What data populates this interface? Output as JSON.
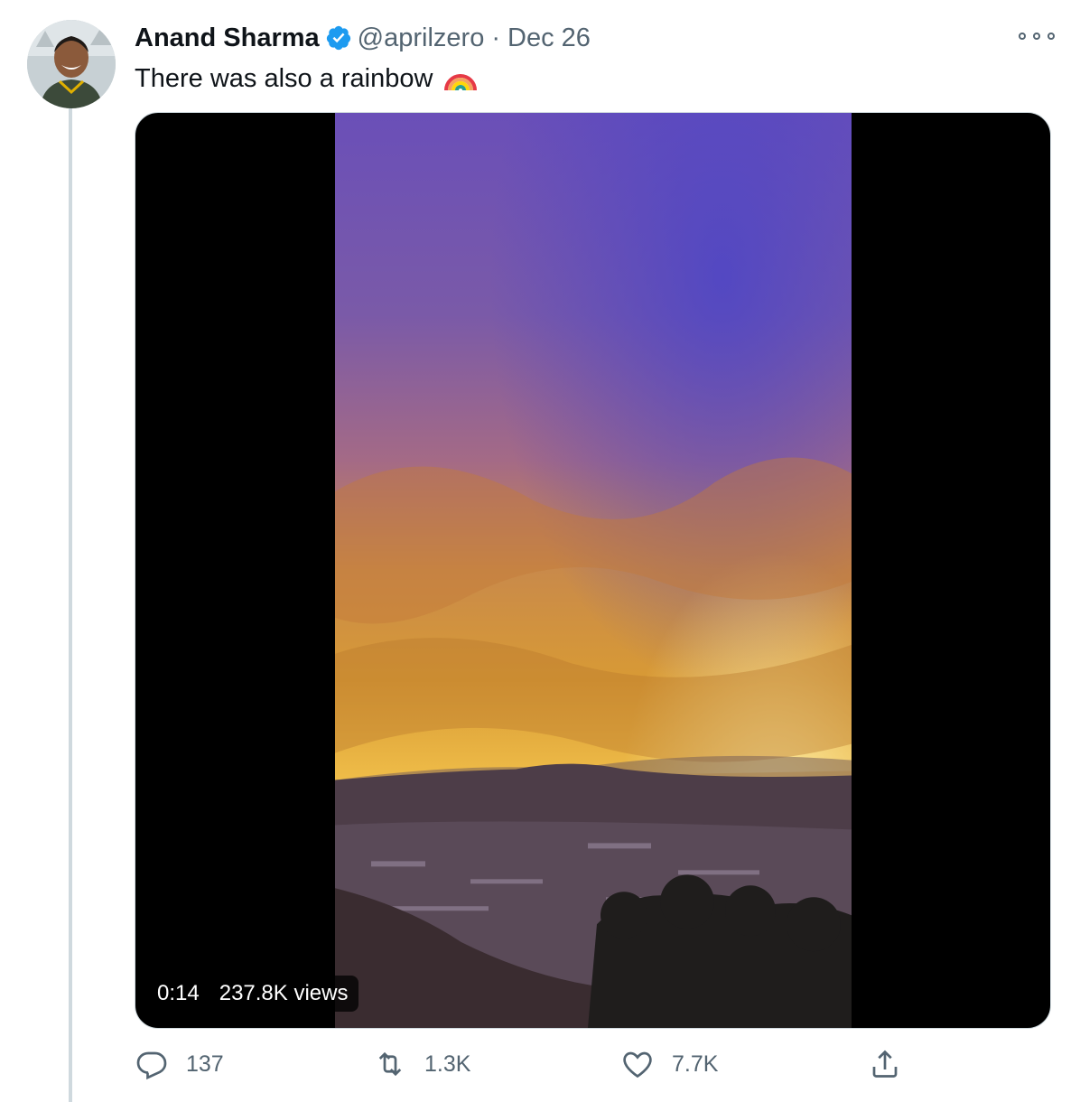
{
  "tweet": {
    "author_name": "Anand Sharma",
    "handle": "@aprilzero",
    "separator": "·",
    "date": "Dec 26",
    "text": "There was also a rainbow",
    "emoji": "rainbow-emoji",
    "verified_icon": "verified-badge-icon",
    "more_icon": "more-options-icon",
    "verified_color": "#1d9bf0"
  },
  "media": {
    "type": "video",
    "duration": "0:14",
    "views": "237.8K views"
  },
  "actions": {
    "reply": {
      "icon": "reply-icon",
      "count": "137"
    },
    "retweet": {
      "icon": "retweet-icon",
      "count": "1.3K"
    },
    "like": {
      "icon": "heart-icon",
      "count": "7.7K"
    },
    "share": {
      "icon": "share-icon"
    }
  }
}
